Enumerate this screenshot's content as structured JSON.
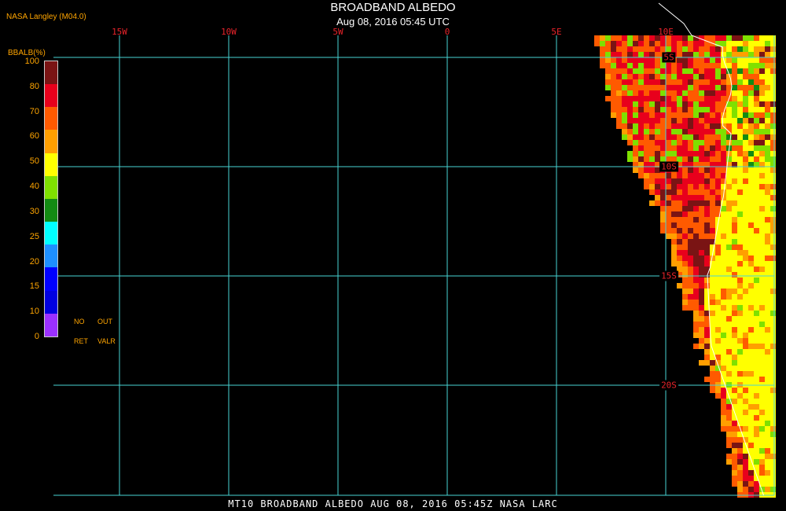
{
  "header": {
    "credit": "NASA Langley (M04.0)",
    "title": "BROADBAND ALBEDO",
    "subtitle": "Aug 08, 2016 05:45 UTC"
  },
  "longitude_labels": [
    {
      "text": "15W",
      "lon": -15
    },
    {
      "text": "10W",
      "lon": -10
    },
    {
      "text": "5W",
      "lon": -5
    },
    {
      "text": "0",
      "lon": 0
    },
    {
      "text": "5E",
      "lon": 5
    },
    {
      "text": "10E",
      "lon": 10
    }
  ],
  "latitude_labels": [
    {
      "text": "5S",
      "lat": -5
    },
    {
      "text": "10S",
      "lat": -10
    },
    {
      "text": "15S",
      "lat": -15
    },
    {
      "text": "20S",
      "lat": -20
    }
  ],
  "legend": {
    "title": "BBALB(%)",
    "ticks": [
      "100",
      "80",
      "70",
      "60",
      "50",
      "40",
      "30",
      "25",
      "20",
      "15",
      "10",
      "0"
    ],
    "colors": [
      "#7a1414",
      "#e8001c",
      "#ff5a00",
      "#ff9f00",
      "#ffff00",
      "#7fe000",
      "#138a13",
      "#00ffff",
      "#1e90ff",
      "#0000ff",
      "#0000e0",
      "#9b30ff"
    ],
    "nodata_line1": [
      "NO",
      "OUT"
    ],
    "nodata_line2": [
      "RET",
      "VALR"
    ]
  },
  "map": {
    "grid_color": "#47d4d4",
    "label_color": "#e8232a",
    "coast_color": "#ffffff"
  },
  "footer": {
    "text": "MT10   BROADBAND ALBEDO   AUG 08, 2016 05:45Z   NASA LARC"
  }
}
